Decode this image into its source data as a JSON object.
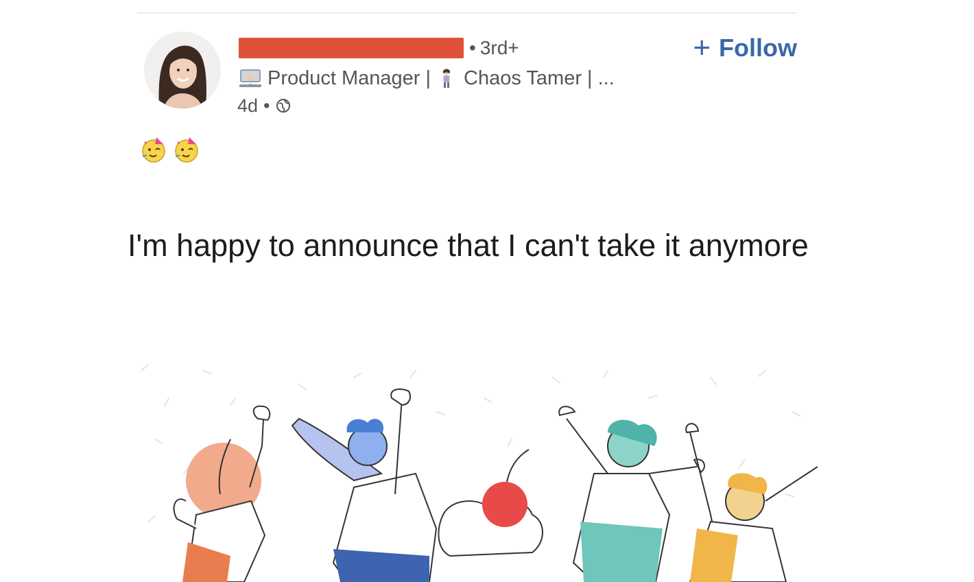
{
  "post": {
    "author": {
      "connection_degree": "3rd+",
      "headline_part1": "Product Manager |",
      "headline_part2": "Chaos Tamer | ..."
    },
    "meta": {
      "age": "4d",
      "separator": "•",
      "visibility_icon": "globe-icon"
    },
    "follow": {
      "icon": "+",
      "label": "Follow"
    },
    "body": {
      "emojis": [
        "partying-face-icon",
        "partying-face-icon"
      ],
      "text": "I'm happy to announce that I can't take it anymore"
    }
  },
  "colors": {
    "redaction": "#e0513a",
    "follow_link": "#3a67a8",
    "body_text": "#1c1c1c",
    "meta_text": "#555555"
  }
}
